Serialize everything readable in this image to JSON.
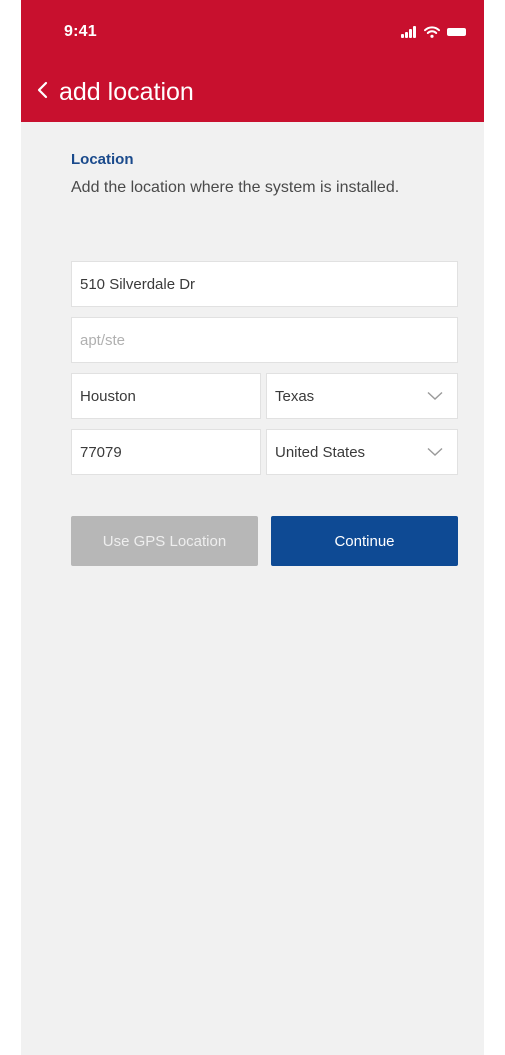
{
  "status_bar": {
    "time": "9:41",
    "icons": [
      "signal-icon",
      "wifi-icon",
      "battery-icon"
    ]
  },
  "header": {
    "back_icon": "chevron-left-icon",
    "title": "add location",
    "background_color": "#c8102e"
  },
  "section": {
    "title": "Location",
    "description": "Add the location where the system is installed."
  },
  "form": {
    "street": {
      "value": "510 Silverdale Dr"
    },
    "apt": {
      "value": "",
      "placeholder": "apt/ste"
    },
    "city": {
      "value": "Houston"
    },
    "state": {
      "value": "Texas"
    },
    "zip": {
      "value": "77079"
    },
    "country": {
      "value": "United States"
    }
  },
  "buttons": {
    "gps_label": "Use GPS Location",
    "continue_label": "Continue",
    "primary_color": "#0e4a94",
    "disabled_color": "#b7b7b7"
  }
}
